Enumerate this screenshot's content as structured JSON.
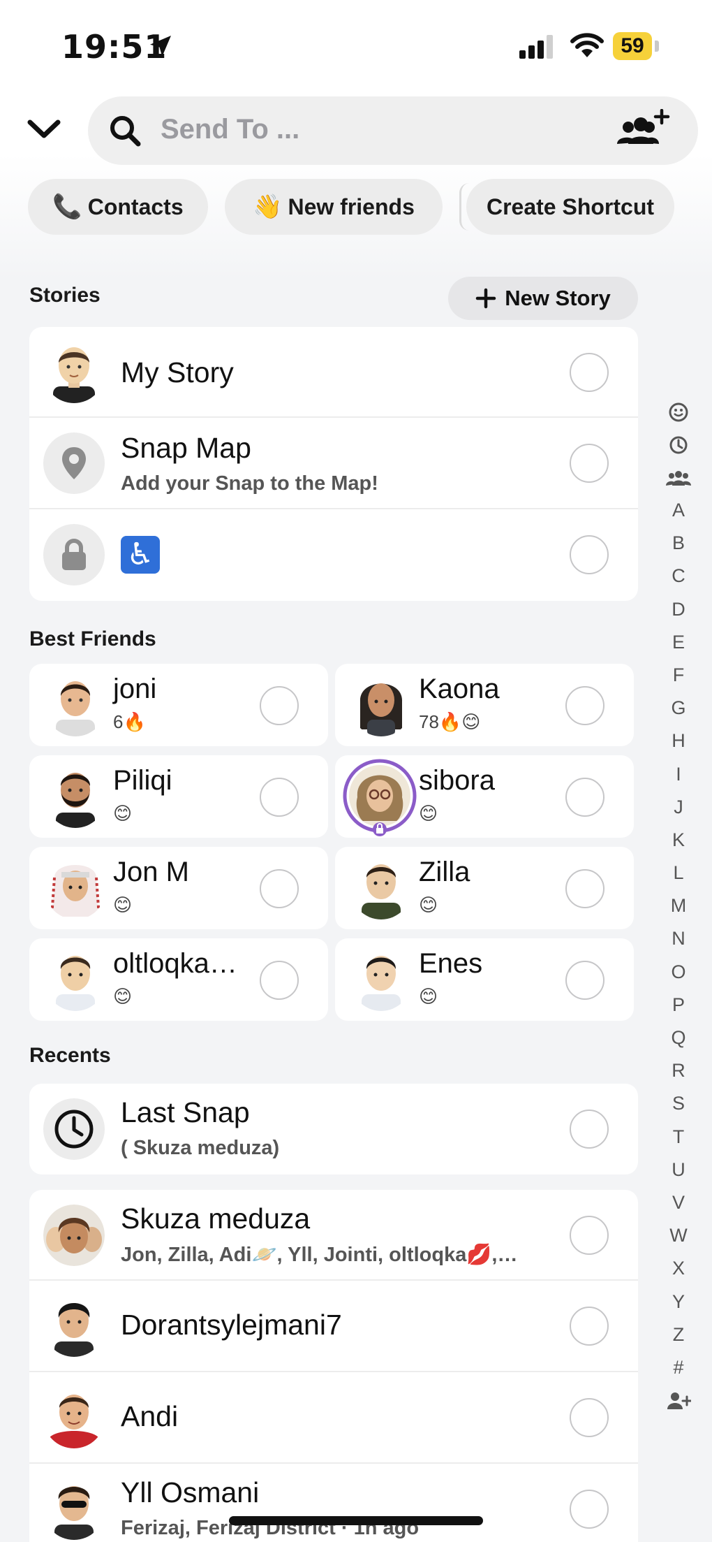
{
  "status": {
    "time": "19:51",
    "battery": "59"
  },
  "search": {
    "placeholder": "Send To ..."
  },
  "chips": {
    "contacts": {
      "label": "Contacts",
      "emoji": "📞"
    },
    "new_friends": {
      "label": "New friends",
      "emoji": "👋"
    },
    "create_shortcut": {
      "label": "Create Shortcut"
    }
  },
  "stories": {
    "title": "Stories",
    "new_story_label": "New Story",
    "items": [
      {
        "name": "My Story",
        "sub": ""
      },
      {
        "name": "Snap Map",
        "sub": "Add your Snap to the Map!"
      },
      {
        "name": "♿",
        "sub": ""
      }
    ]
  },
  "best_friends": {
    "title": "Best Friends",
    "items": [
      {
        "name": "joni",
        "sub": "6🔥"
      },
      {
        "name": "Kaona",
        "sub": "78🔥😊"
      },
      {
        "name": "Piliqi",
        "sub": "😊"
      },
      {
        "name": "sibora",
        "sub": "😊"
      },
      {
        "name": "Jon M",
        "sub": "😊"
      },
      {
        "name": "Zilla",
        "sub": "😊"
      },
      {
        "name": "oltloqka…",
        "sub": "😊"
      },
      {
        "name": "Enes",
        "sub": "😊"
      }
    ]
  },
  "recents": {
    "title": "Recents",
    "last_snap": {
      "name": "Last Snap",
      "sub": "( Skuza meduza)"
    },
    "items": [
      {
        "name": "Skuza meduza",
        "sub": "Jon, Zilla, Adi🪐, Yll, Jointi, oltloqka💋,…"
      },
      {
        "name": "Dorantsylejmani7",
        "sub": ""
      },
      {
        "name": "Andi",
        "sub": ""
      },
      {
        "name": "Yll Osmani",
        "sub": "Ferizaj, Ferizaj District · 1h ago"
      }
    ]
  },
  "index_letters": [
    "A",
    "B",
    "C",
    "D",
    "E",
    "F",
    "G",
    "H",
    "I",
    "J",
    "K",
    "L",
    "M",
    "N",
    "O",
    "P",
    "Q",
    "R",
    "S",
    "T",
    "U",
    "V",
    "W",
    "X",
    "Y",
    "Z",
    "#"
  ]
}
